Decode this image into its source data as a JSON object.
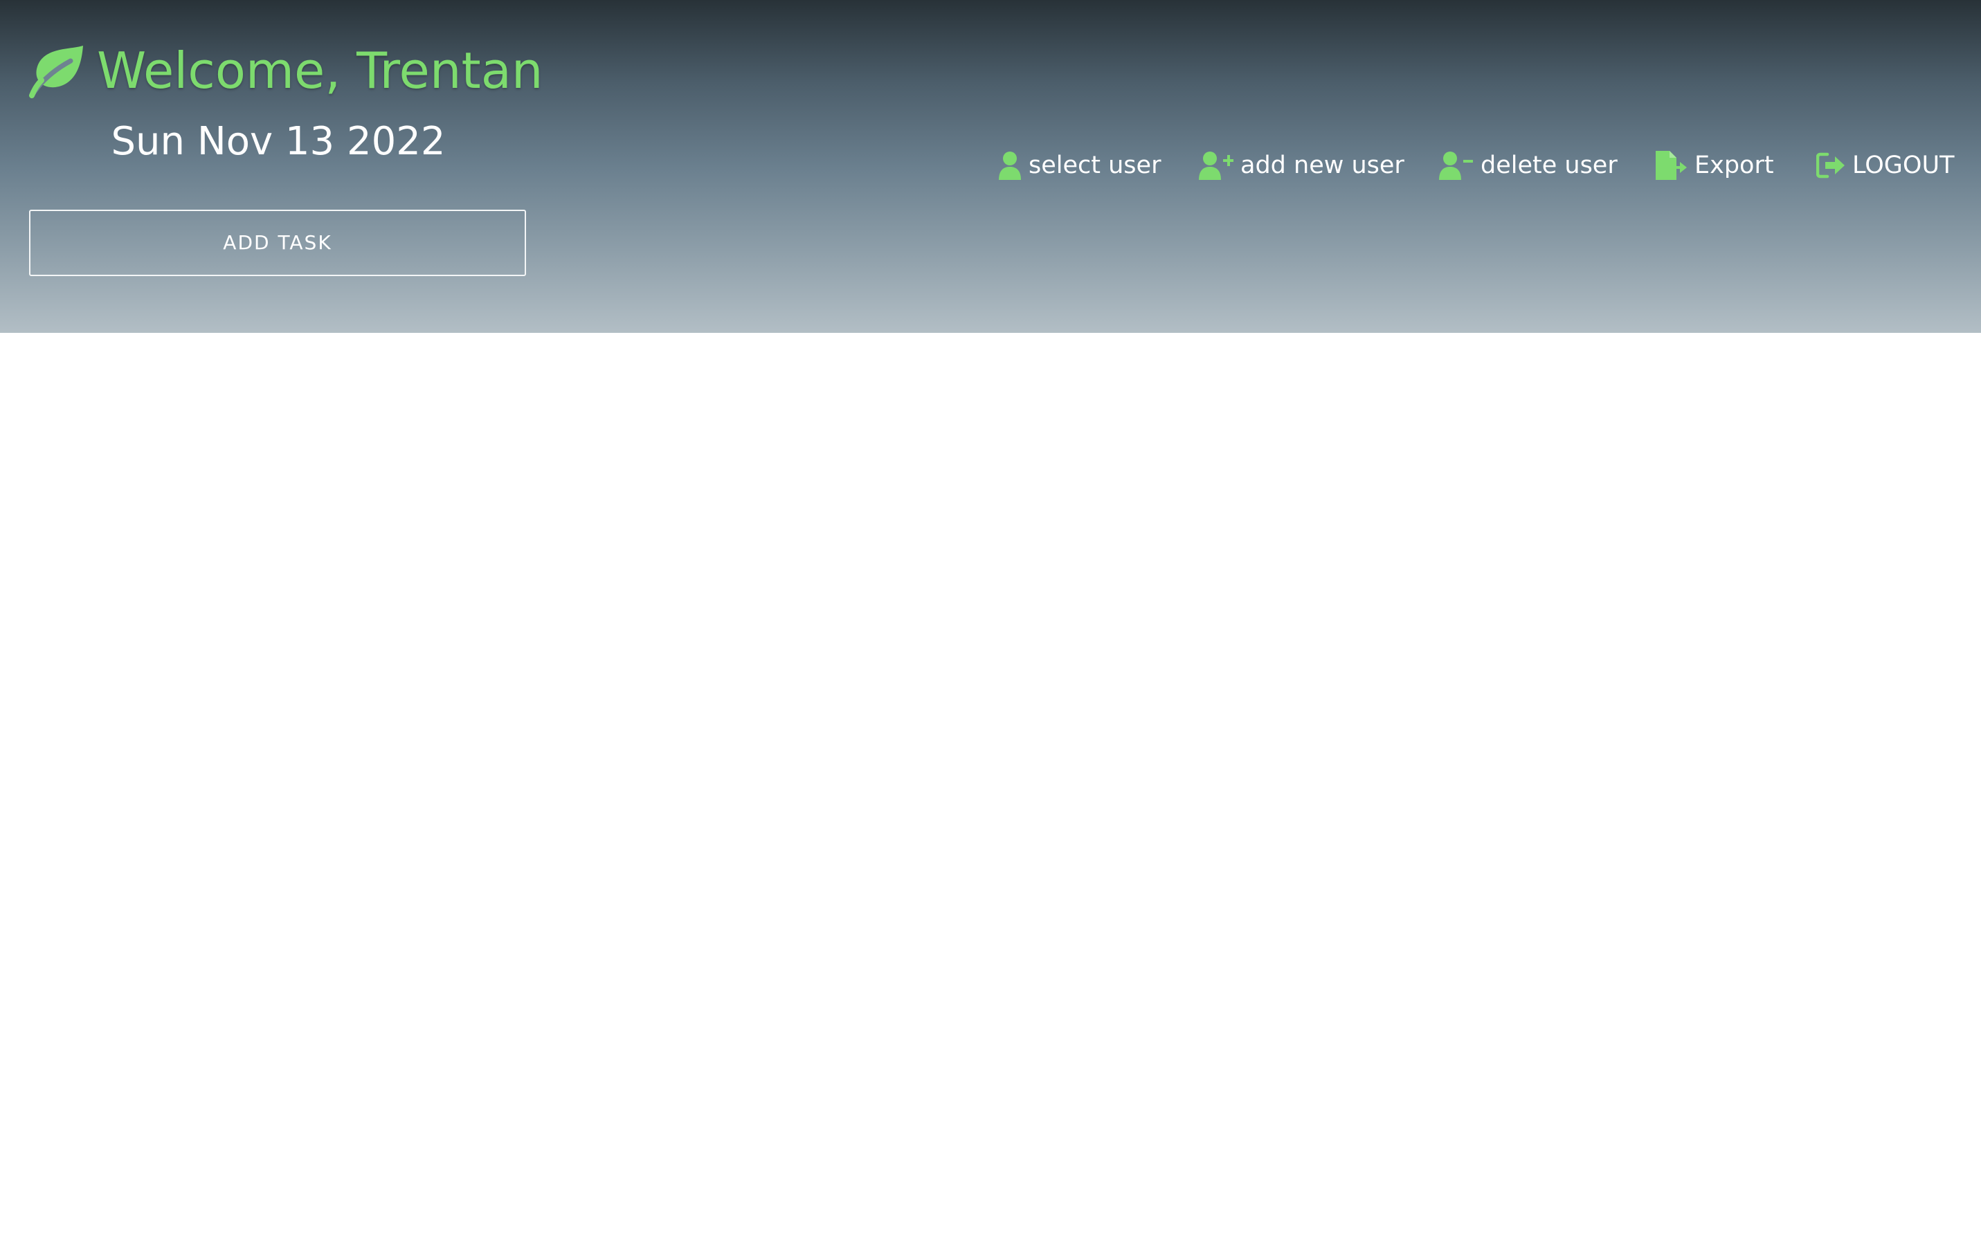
{
  "header": {
    "welcome_text": "Welcome, Trentan",
    "date_text": "Sun Nov 13 2022",
    "add_task_label": "ADD TASK",
    "brand_icon": "leaf-icon",
    "accent_color": "#7ddb6e"
  },
  "nav": {
    "select_user": {
      "label": "select user",
      "icon": "user-icon"
    },
    "add_new_user": {
      "label": "add new user",
      "icon": "user-plus-icon"
    },
    "delete_user": {
      "label": "delete user",
      "icon": "user-minus-icon"
    },
    "export": {
      "label": "Export",
      "icon": "file-export-icon"
    },
    "logout": {
      "label": "LOGOUT",
      "icon": "sign-out-icon"
    }
  }
}
